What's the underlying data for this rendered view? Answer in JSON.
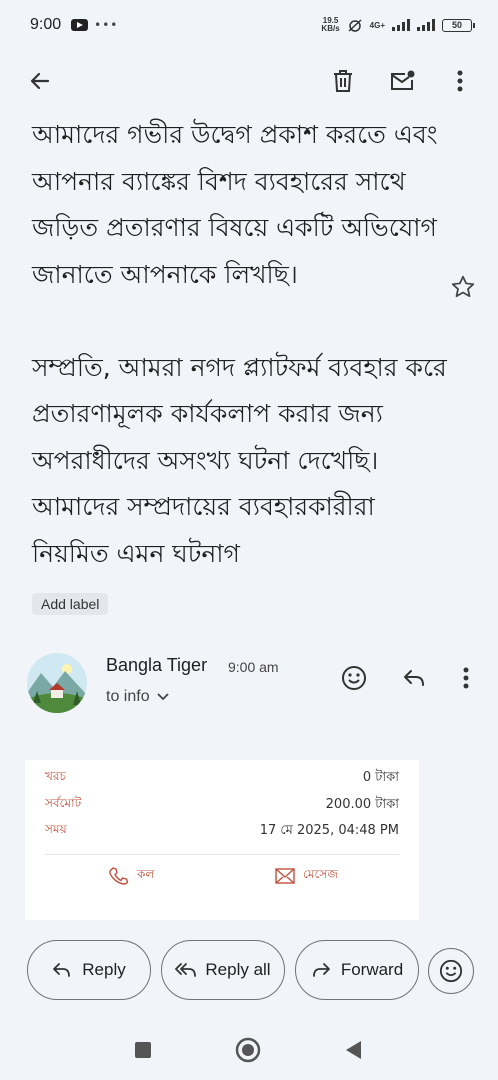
{
  "status_bar": {
    "time": "9:00",
    "net_speed_value": "19.5",
    "net_speed_unit": "KB/s",
    "network_type": "4G+",
    "battery": "50"
  },
  "toolbar": {
    "back_icon": "arrow-left-icon",
    "delete_icon": "trash-icon",
    "mark_unread_icon": "mail-unread-icon",
    "more_icon": "more-vertical-icon"
  },
  "message": {
    "paragraph1": "আমাদের গভীর উদ্বেগ প্রকাশ করতে এবং আপনার ব্যাঙ্কের বিশদ ব্যবহারের সাথে জড়িত প্রতারণার বিষয়ে একটি অভিযোগ জানাতে আপনাকে লিখছি।",
    "paragraph2": "সম্প্রতি, আমরা নগদ প্ল্যাটফর্ম ব্যবহার করে প্রতারণামূলক কার্যকলাপ করার জন্য অপরাধীদের অসংখ্য ঘটনা দেখেছি। আমাদের সম্প্রদায়ের ব্যবহারকারীরা নিয়মিত এমন ঘটনাগ",
    "add_label": "Add label"
  },
  "sender": {
    "name": "Bangla Tiger",
    "time": "9:00 am",
    "to": "to info"
  },
  "receipt": {
    "rows": [
      {
        "label": "খরচ",
        "value": "0 টাকা"
      },
      {
        "label": "সর্বমোট",
        "value": "200.00 টাকা"
      },
      {
        "label": "সময়",
        "value": "17 মে 2025, 04:48 PM"
      }
    ],
    "call_label": "কল",
    "message_label": "মেসেজ"
  },
  "actions": {
    "reply": "Reply",
    "reply_all": "Reply all",
    "forward": "Forward"
  },
  "colors": {
    "background": "#f1f4f9",
    "accent_receipt": "#c0513c"
  }
}
